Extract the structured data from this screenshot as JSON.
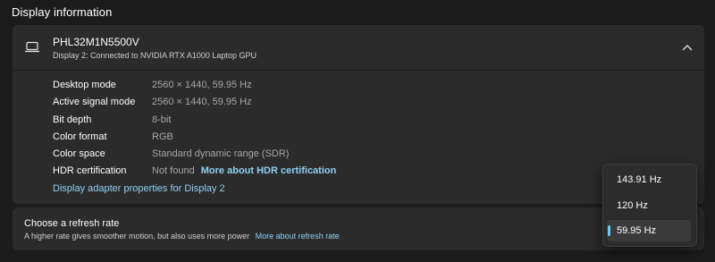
{
  "section": {
    "title": "Display information"
  },
  "monitor": {
    "name": "PHL32M1N5500V",
    "subtitle": "Display 2: Connected to NVIDIA RTX A1000 Laptop GPU"
  },
  "info": [
    {
      "label": "Desktop mode",
      "value": "2560 × 1440, 59.95 Hz"
    },
    {
      "label": "Active signal mode",
      "value": "2560 × 1440, 59.95 Hz"
    },
    {
      "label": "Bit depth",
      "value": "8-bit"
    },
    {
      "label": "Color format",
      "value": "RGB"
    },
    {
      "label": "Color space",
      "value": "Standard dynamic range (SDR)"
    },
    {
      "label": "HDR certification",
      "value": "Not found",
      "link": "More about HDR certification"
    }
  ],
  "adapter_link": "Display adapter properties for Display 2",
  "refresh": {
    "title": "Choose a refresh rate",
    "description": "A higher rate gives smoother motion, but also uses more power",
    "link": "More about refresh rate"
  },
  "dropdown": {
    "options": [
      "143.91 Hz",
      "120 Hz",
      "59.95 Hz"
    ],
    "selected": "59.95 Hz"
  },
  "colors": {
    "accent": "#60cdff",
    "link": "#8ed1f5",
    "card": "#2b2b2b",
    "background": "#1c1c1c"
  },
  "icons": {
    "monitor": "laptop-monitor-icon",
    "collapse": "chevron-up-icon"
  }
}
